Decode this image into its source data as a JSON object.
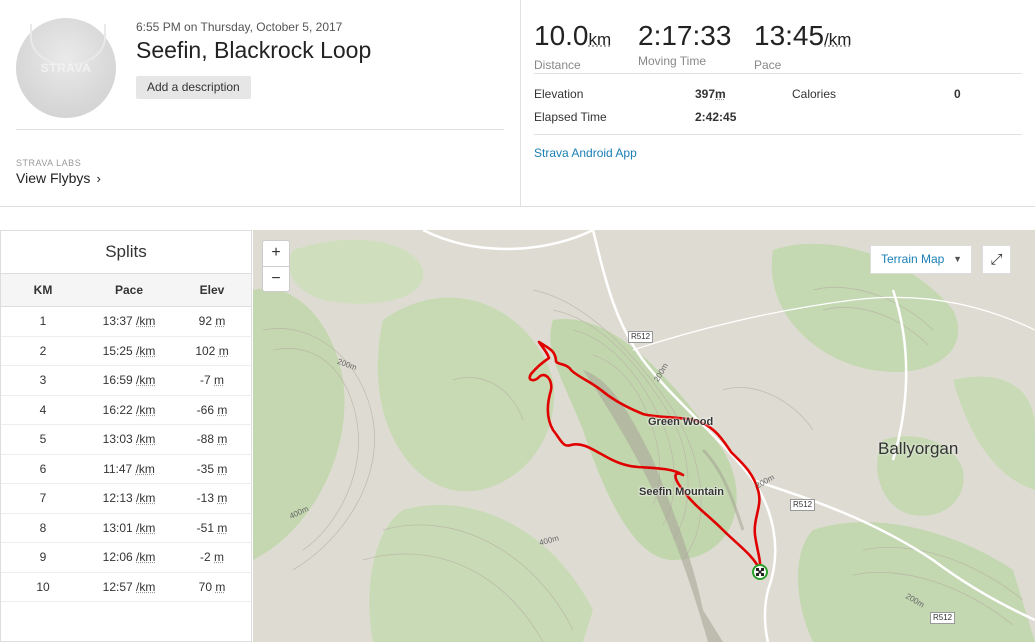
{
  "activity": {
    "avatar_logo": "STRAVA",
    "datetime": "6:55 PM on Thursday, October 5, 2017",
    "title": "Seefin, Blackrock Loop",
    "add_description": "Add a description",
    "labs_label": "STRAVA LABS",
    "flybys_label": "View Flybys"
  },
  "stats": {
    "distance": {
      "value": "10.0",
      "unit": "km",
      "label": "Distance"
    },
    "moving_time": {
      "value": "2:17:33",
      "label": "Moving Time"
    },
    "pace": {
      "value": "13:45",
      "unit": "/km",
      "label": "Pace"
    },
    "elevation_label": "Elevation",
    "elevation_value": "397",
    "elevation_unit": "m",
    "calories_label": "Calories",
    "calories_value": "0",
    "elapsed_label": "Elapsed Time",
    "elapsed_value": "2:42:45",
    "device": "Strava Android App"
  },
  "splits": {
    "title": "Splits",
    "headers": {
      "km": "KM",
      "pace": "Pace",
      "elev": "Elev"
    },
    "pace_unit": "/km",
    "elev_unit": "m",
    "rows": [
      {
        "km": "1",
        "pace": "13:37",
        "elev": "92"
      },
      {
        "km": "2",
        "pace": "15:25",
        "elev": "102"
      },
      {
        "km": "3",
        "pace": "16:59",
        "elev": "-7"
      },
      {
        "km": "4",
        "pace": "16:22",
        "elev": "-66"
      },
      {
        "km": "5",
        "pace": "13:03",
        "elev": "-88"
      },
      {
        "km": "6",
        "pace": "11:47",
        "elev": "-35"
      },
      {
        "km": "7",
        "pace": "12:13",
        "elev": "-13"
      },
      {
        "km": "8",
        "pace": "13:01",
        "elev": "-51"
      },
      {
        "km": "9",
        "pace": "12:06",
        "elev": "-2"
      },
      {
        "km": "10",
        "pace": "12:57",
        "elev": "70"
      }
    ]
  },
  "map": {
    "zoom_in": "+",
    "zoom_out": "−",
    "map_type": "Terrain Map",
    "places": {
      "green_wood": "Green Wood",
      "seefin": "Seefin Mountain",
      "ballyorgan": "Ballyorgan"
    },
    "roads": {
      "r512": "R512"
    },
    "contours": {
      "c200": "200m",
      "c400": "400m"
    },
    "route_color": "#e00000"
  }
}
